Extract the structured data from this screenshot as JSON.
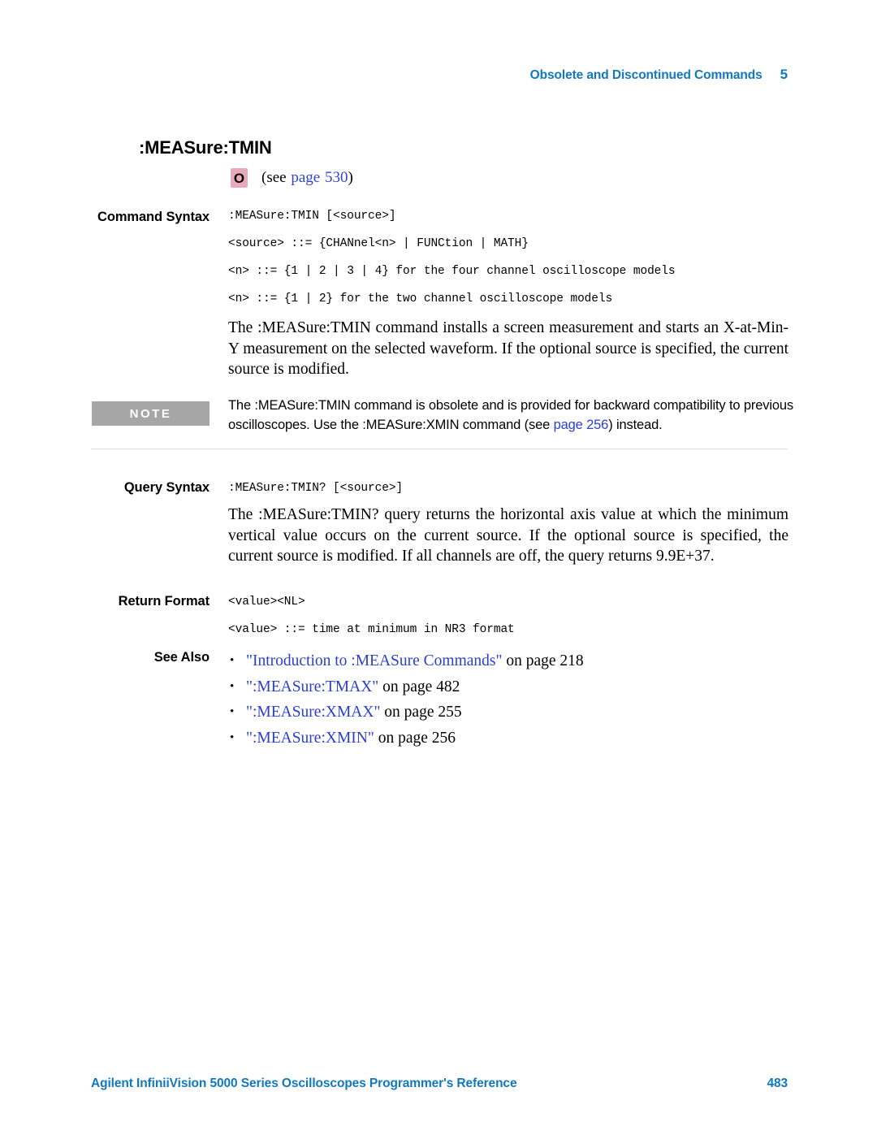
{
  "header": {
    "chapter_title": "Obsolete and Discontinued Commands",
    "chapter_number": "5"
  },
  "command": {
    "title": ":MEASure:TMIN",
    "obsolete_badge": "O",
    "see_prefix": "(see",
    "see_link": "page",
    "see_page_number": "530",
    "see_suffix": ")"
  },
  "command_syntax": {
    "label": "Command Syntax",
    "lines": [
      ":MEASure:TMIN [<source>]",
      "<source> ::= {CHANnel<n> | FUNCtion | MATH}",
      "<n> ::= {1 | 2 | 3 | 4} for the four channel oscilloscope models",
      "<n> ::= {1 | 2} for the two channel oscilloscope models"
    ],
    "description": "The :MEASure:TMIN command installs a screen measurement and starts an X-​at-​Min-​Y measurement on the selected waveform. If the optional source is specified, the current source is modified."
  },
  "note": {
    "tag": "NOTE",
    "text_before_link": "The :MEASure:TMIN command is obsolete and is provided for backward compatibility to previous oscilloscopes. Use the :MEASure:XMIN command (see ",
    "link_text": "page 256",
    "text_after_link": ") instead."
  },
  "query_syntax": {
    "label": "Query Syntax",
    "lines": [
      ":MEASure:TMIN? [<source>]"
    ],
    "description": "The :MEASure:TMIN? query returns the horizontal axis value at which the minimum vertical value occurs on the current source. If the optional source is specified, the current source is modified. If all channels are off, the query returns 9.9E+37."
  },
  "return_format": {
    "label": "Return Format",
    "lines": [
      "<value><NL>",
      "<value> ::= time at minimum in NR3 format"
    ]
  },
  "see_also": {
    "label": "See Also",
    "bullet": "•",
    "items": [
      {
        "link": "\"Introduction to :MEASure Commands\"",
        "tail": "on page 218"
      },
      {
        "link": "\":MEASure:TMAX\"",
        "tail": "on page 482"
      },
      {
        "link": "\":MEASure:XMAX\"",
        "tail": "on page 255"
      },
      {
        "link": "\":MEASure:XMIN\"",
        "tail": "on page 256"
      }
    ]
  },
  "footer": {
    "manual_title": "Agilent InfiniiVision 5000 Series Oscilloscopes Programmer's Reference",
    "page_number": "483"
  },
  "colors": {
    "header_blue": "#1278be",
    "link_blue": "#2a3fd0",
    "badge_pink": "#e9a9bd",
    "note_gray": "#a6a6a6",
    "rule_gray": "#dcdcdc"
  }
}
